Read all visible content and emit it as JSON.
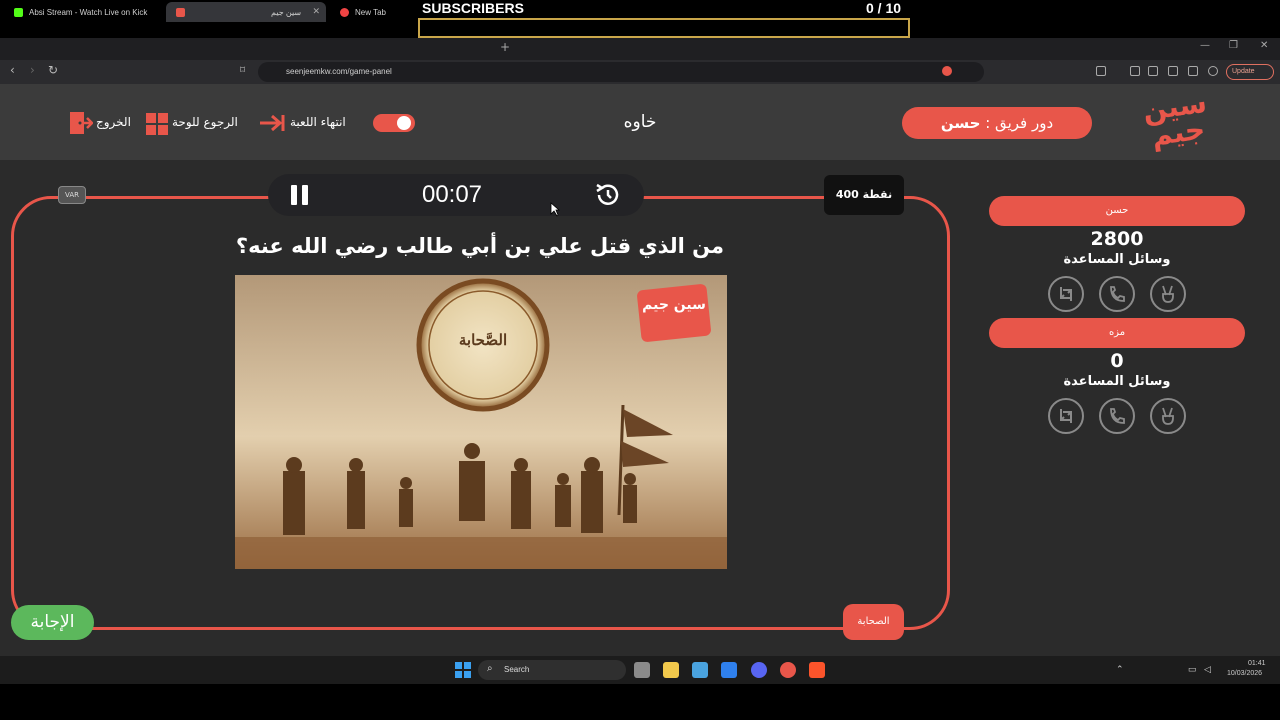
{
  "overlay": {
    "label": "SUBSCRIBERS",
    "count": "0  / 10"
  },
  "browser": {
    "tabs": [
      {
        "title": "Absi Stream - Watch Live on Kick"
      },
      {
        "title": "سين جيم"
      },
      {
        "title": "New Tab"
      }
    ],
    "url": "seenjeemkw.com/game-panel",
    "update_label": "Update"
  },
  "header": {
    "logo_text": "سين جيم",
    "turn_prefix": "دور فريق :",
    "turn_team": "حسن",
    "category": "خاوه",
    "end_game": "انتهاء اللعبة",
    "back_to_board": "الرجوع للوحة",
    "exit": "الخروج"
  },
  "game": {
    "timer": "00:07",
    "points": "400 نقطة",
    "var_label": "VAR",
    "question": "من الذي قتل علي بن أبي طالب رضي الله عنه؟",
    "image_seal_text": "الصَّحابة",
    "image_watermark": "سين جيم",
    "answer_button": "الإجابة",
    "category_badge": "الصحابة"
  },
  "teams": [
    {
      "name": "حسن",
      "score": "2800",
      "aids_label": "وسائل المساعدة"
    },
    {
      "name": "مزه",
      "score": "0",
      "aids_label": "وسائل المساعدة"
    }
  ],
  "taskbar": {
    "search": "Search",
    "time": "01:41",
    "date": "10/03/2026"
  },
  "colors": {
    "accent": "#e8564a",
    "answer": "#5cb85c",
    "background": "#2b2b2b",
    "header": "#3b3b3b"
  }
}
